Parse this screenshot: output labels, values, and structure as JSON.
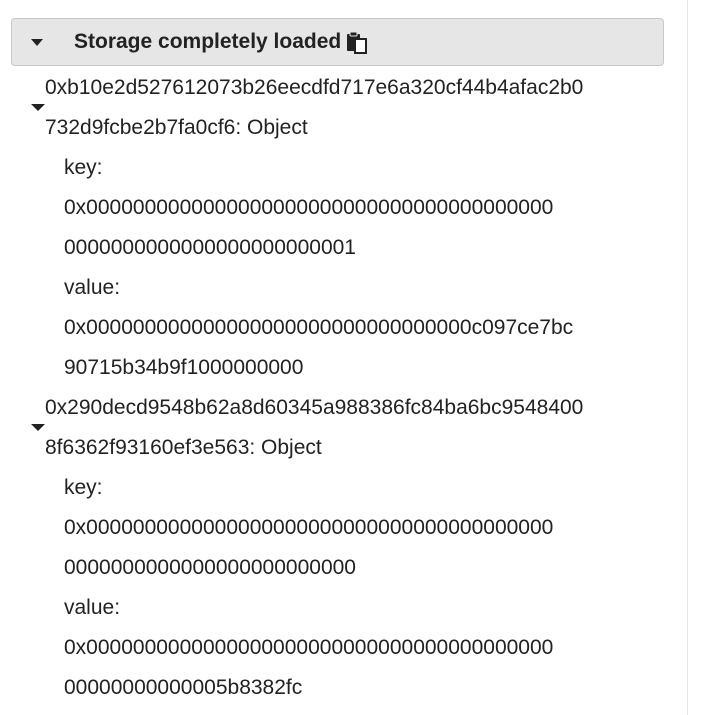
{
  "panel": {
    "title": "Storage completely loaded",
    "icons": {
      "toggle": "caret-down-icon",
      "copy": "copy-clipboard-icon"
    }
  },
  "entries": [
    {
      "hash_line1": "0xb10e2d527612073b26eecdfd717e6a320cf44b4afac2b0",
      "hash_line2": "732d9fcbe2b7fa0cf6: Object",
      "key_label": "key:",
      "key_line1": "0x0000000000000000000000000000000000000000",
      "key_line2": "0000000000000000000000001",
      "value_label": "value:",
      "value_line1": "0x000000000000000000000000000000000c097ce7bc",
      "value_line2": "90715b34b9f1000000000"
    },
    {
      "hash_line1": "0x290decd9548b62a8d60345a988386fc84ba6bc9548400",
      "hash_line2": "8f6362f93160ef3e563: Object",
      "key_label": "key:",
      "key_line1": "0x0000000000000000000000000000000000000000",
      "key_line2": "0000000000000000000000000",
      "value_label": "value:",
      "value_line1": "0x0000000000000000000000000000000000000000",
      "value_line2": "00000000000005b8382fc"
    }
  ]
}
